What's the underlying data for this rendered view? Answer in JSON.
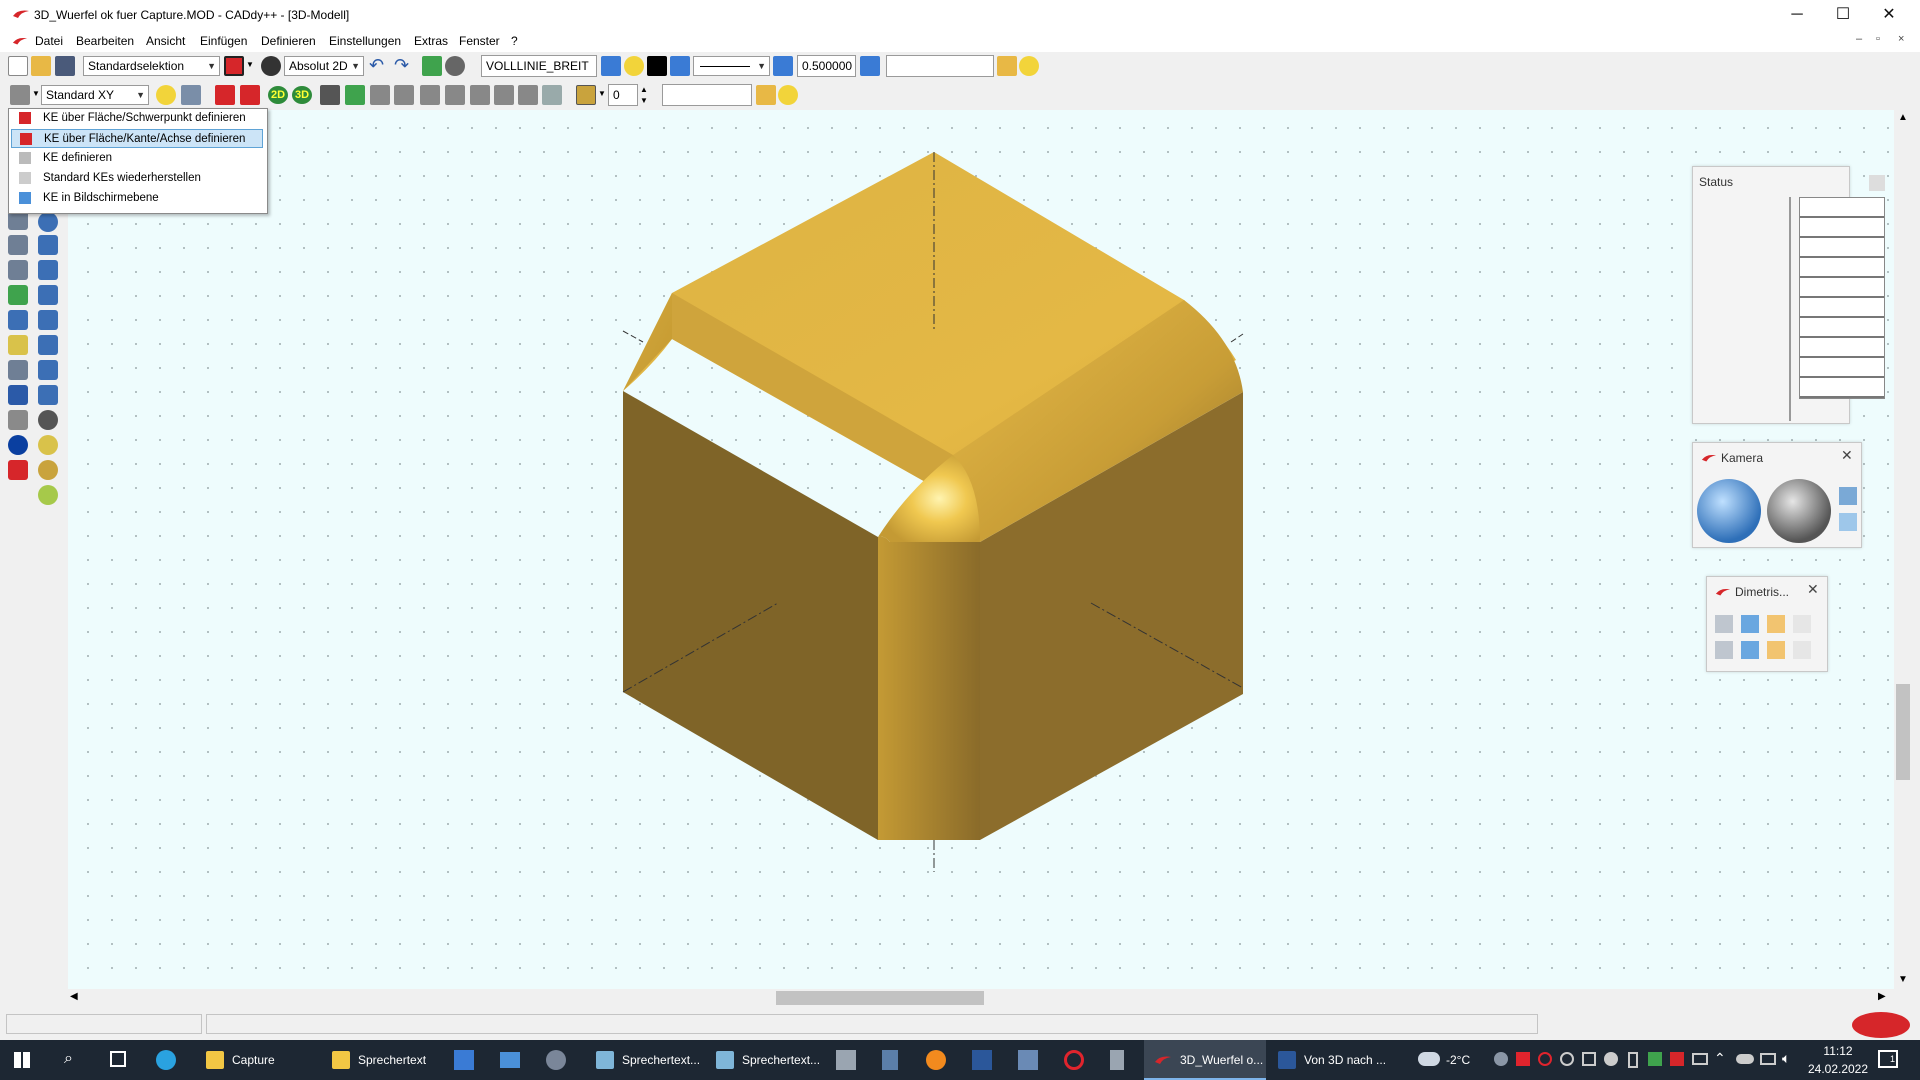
{
  "window": {
    "title": "3D_Wuerfel ok fuer Capture.MOD  -  CADdy++ - [3D-Modell]",
    "minimize": "─",
    "maximize": "☐",
    "close": "✕"
  },
  "menu": {
    "items": [
      "Datei",
      "Bearbeiten",
      "Ansicht",
      "Einfügen",
      "Definieren",
      "Einstellungen",
      "Extras",
      "Fenster",
      "?"
    ],
    "mdi": [
      "–",
      "▫",
      "×"
    ]
  },
  "toolbar1": {
    "selection": "Standardselektion",
    "coord_mode": "Absolut 2D",
    "line_type": "VOLLLINIE_BREIT",
    "line_width": "0.500000",
    "extra_field": ""
  },
  "toolbar2": {
    "plane": "Standard XY",
    "btn_2d": "2D",
    "btn_3d": "3D",
    "layer_num": "0",
    "layer_field": ""
  },
  "dropdown": {
    "items": [
      "KE über Fläche/Schwerpunkt definieren",
      "KE über Fläche/Kante/Achse definieren",
      "KE definieren",
      "Standard KEs wiederherstellen",
      "KE in Bildschirmebene"
    ]
  },
  "panels": {
    "status": "Status",
    "kamera": "Kamera",
    "dimetris": "Dimetris..."
  },
  "taskbar": {
    "apps": [
      {
        "label": "Capture",
        "color": "#f2c744"
      },
      {
        "label": "Sprechertext",
        "color": "#f2c744"
      },
      {
        "label": "Sprechertext...",
        "color": "#7fb6d9"
      },
      {
        "label": "Sprechertext...",
        "color": "#7fb6d9"
      },
      {
        "label": "3D_Wuerfel o...",
        "color": "#d6262a"
      },
      {
        "label": "Von 3D nach ...",
        "color": "#2b579a"
      }
    ],
    "temperature": "-2°C",
    "time": "11:12",
    "date": "24.02.2022",
    "notifications": "1"
  },
  "colors": {
    "accent": "#d6262a",
    "cube_top": "#ddb344",
    "cube_left": "#7f6428",
    "cube_right": "#8c6d2c",
    "canvas": "#eefcfd"
  }
}
